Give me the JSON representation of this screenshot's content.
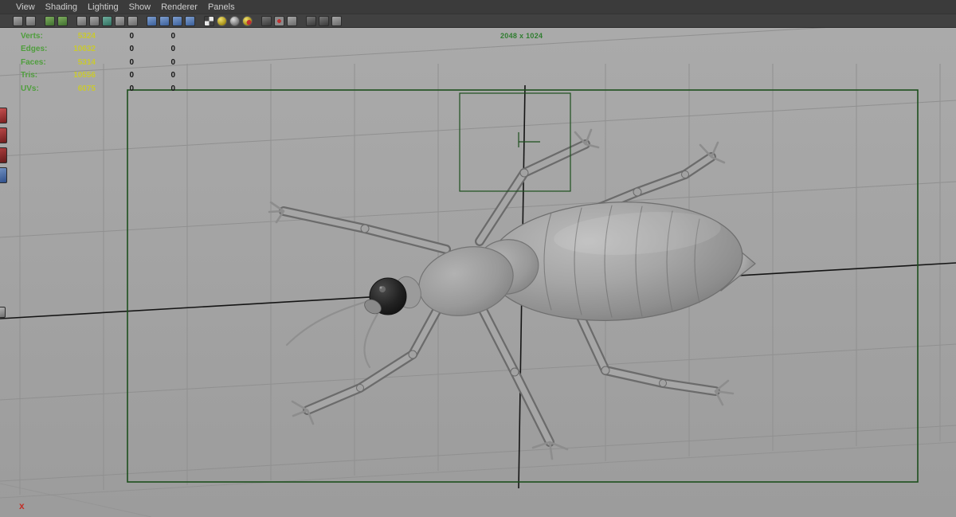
{
  "menu": {
    "items": [
      "View",
      "Shading",
      "Lighting",
      "Show",
      "Renderer",
      "Panels"
    ]
  },
  "toolbar": {
    "icons": [
      "select-camera-icon",
      "camera-attributes-icon",
      "bookmark-icon",
      "image-plane-icon",
      "pan-zoom-icon",
      "grease-pencil-icon",
      "grid-icon",
      "film-gate-icon",
      "resolution-gate-icon",
      "gate-mask-icon",
      "field-chart-icon",
      "safe-action-icon",
      "safe-title-icon",
      "checkerboard-icon",
      "shaded-sphere-icon",
      "wireframe-sphere-icon",
      "textured-sphere-icon",
      "shadows-icon",
      "screen-space-ao-icon",
      "motion-blur-icon",
      "exposure-icon",
      "gamma-icon",
      "share-nodes-icon"
    ]
  },
  "left_toolbox": {
    "icons": [
      "toolbox-icon-1",
      "toolbox-icon-2",
      "toolbox-icon-3",
      "toolbox-icon-4",
      "toolbox-icon-5"
    ]
  },
  "hud": {
    "rows": [
      {
        "label": "Verts:",
        "v1": "5324",
        "v2": "0",
        "v3": "0"
      },
      {
        "label": "Edges:",
        "v1": "10632",
        "v2": "0",
        "v3": "0"
      },
      {
        "label": "Faces:",
        "v1": "5314",
        "v2": "0",
        "v3": "0"
      },
      {
        "label": "Tris:",
        "v1": "10556",
        "v2": "0",
        "v3": "0"
      },
      {
        "label": "UVs:",
        "v1": "6075",
        "v2": "0",
        "v3": "0"
      }
    ]
  },
  "viewport": {
    "resolution_label": "2048 x 1024",
    "error_marker": "x",
    "model": "insect-3d-model"
  },
  "colors": {
    "menubar_bg": "#3b3b3b",
    "viewport_bg": "#a4a4a4",
    "grid_line": "#909090",
    "axis_line": "#141414",
    "gate_green": "#1d4f1d",
    "hud_label_green": "#4f9e3d",
    "hud_value_yellow": "#c9c931",
    "resolution_text_green": "#2f7d2f",
    "error_red": "#c03028"
  }
}
